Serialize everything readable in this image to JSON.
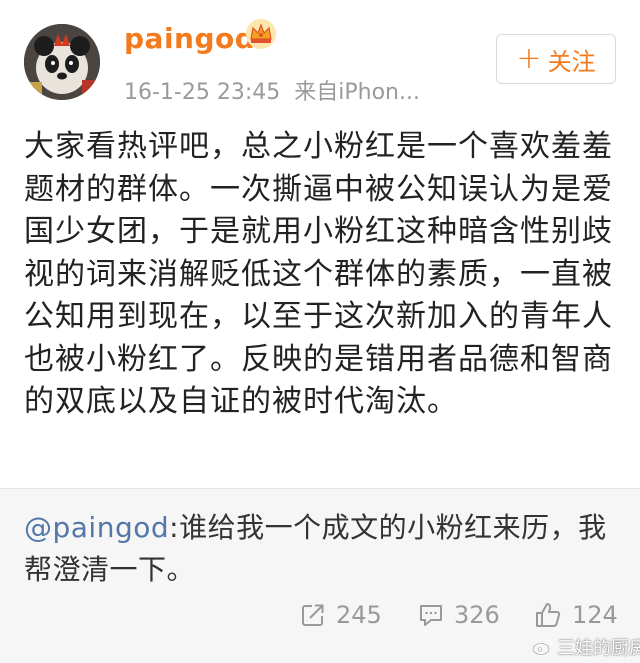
{
  "user": {
    "name": "paingod",
    "avatar_icon": "panda-avatar-icon",
    "badge_icon": "crown-icon"
  },
  "meta": {
    "date": "16-1-25 23:45",
    "source": "来自iPhon..."
  },
  "follow": {
    "label": "关注"
  },
  "post": {
    "text": "大家看热评吧，总之小粉红是一个喜欢羞羞题材的群体。一次撕逼中被公知误认为是爱国少女团，于是就用小粉红这种暗含性别歧视的词来消解贬低这个群体的素质，一直被公知用到现在，以至于这次新加入的青年人也被小粉红了。反映的是错用者品德和智商的双底以及自证的被时代淘汰。"
  },
  "retweet": {
    "mention": "@paingod",
    "text": ":谁给我一个成文的小粉红来历，我帮澄清一下。"
  },
  "actions": {
    "repost_count": "245",
    "comment_count": "326",
    "like_count": "124"
  },
  "watermark": {
    "text": "三娃的厨房"
  },
  "colors": {
    "accent": "#f37b1d",
    "link": "#5377a8",
    "muted": "#9a9a9a"
  }
}
